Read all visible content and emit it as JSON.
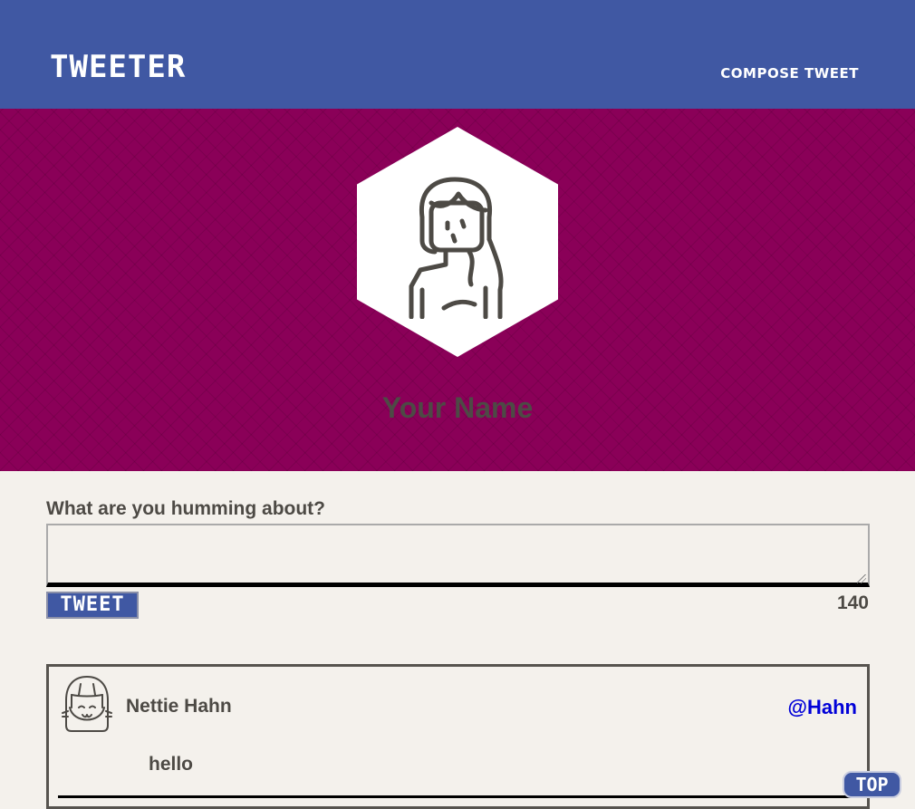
{
  "header": {
    "brand": "TWEETER",
    "compose_link": "COMPOSE TWEET",
    "background_color": "#4058a3"
  },
  "profile": {
    "name": "Your Name",
    "avatar_icon": "woman-avatar-icon",
    "banner_color": "#8a0058"
  },
  "composer": {
    "label": "What are you humming about?",
    "value": "",
    "button_label": "TWEET",
    "char_count": "140"
  },
  "tweets": [
    {
      "avatar_icon": "girl-avatar-icon",
      "name": "Nettie Hahn",
      "handle": "@Hahn",
      "text": "hello"
    }
  ],
  "scroll_top": {
    "label": "TOP"
  }
}
